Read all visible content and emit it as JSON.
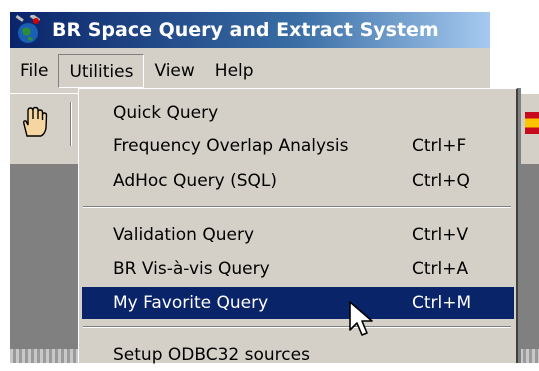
{
  "window": {
    "title": "BR Space Query and Extract System",
    "app_icon": "globe-satellite-icon"
  },
  "menubar": {
    "items": [
      {
        "label": "File"
      },
      {
        "label": "Utilities",
        "open": true
      },
      {
        "label": "View"
      },
      {
        "label": "Help"
      }
    ]
  },
  "toolbar": {
    "hand_icon": "hand-pointer-icon",
    "flag_icon": "spain-flag-icon"
  },
  "utilities_menu": {
    "items": [
      {
        "label": "Quick Query",
        "shortcut": ""
      },
      {
        "label": "Frequency Overlap Analysis",
        "shortcut": "Ctrl+F"
      },
      {
        "label": "AdHoc Query (SQL)",
        "shortcut": "Ctrl+Q"
      },
      {
        "label": "Validation Query",
        "shortcut": "Ctrl+V"
      },
      {
        "label": "BR Vis-à-vis Query",
        "shortcut": "Ctrl+A"
      },
      {
        "label": "My Favorite Query",
        "shortcut": "Ctrl+M",
        "selected": true
      },
      {
        "label": "Setup ODBC32 sources",
        "shortcut": ""
      }
    ]
  },
  "colors": {
    "title_start": "#0a246a",
    "title_end": "#a6caf0",
    "menu_bg": "#d4d0c8",
    "highlight": "#0a246a",
    "client_bg": "#808080"
  }
}
